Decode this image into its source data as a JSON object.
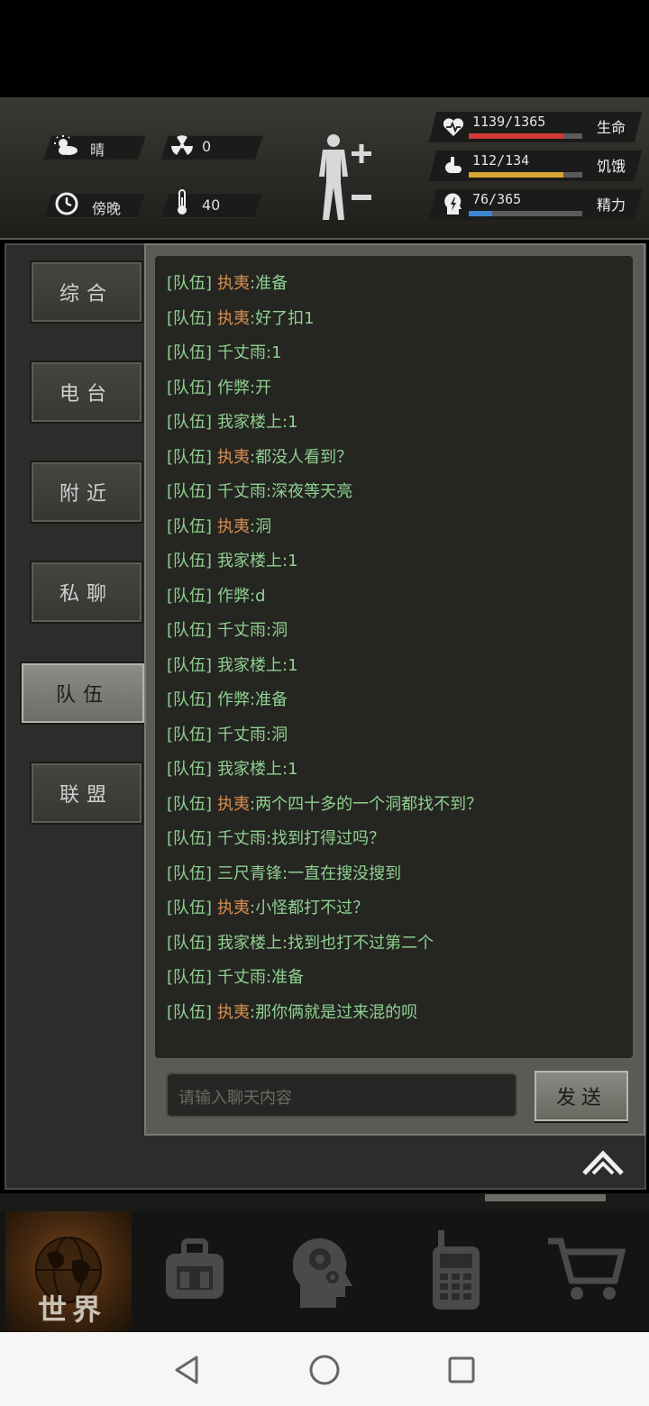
{
  "hud": {
    "weather": {
      "label": "晴",
      "icon": "partly-cloudy-icon"
    },
    "radiation": {
      "value": "0",
      "icon": "radiation-icon"
    },
    "time": {
      "label": "傍晚",
      "icon": "clock-icon"
    },
    "temperature": {
      "value": "40",
      "icon": "thermometer-icon"
    },
    "stats": [
      {
        "name": "health",
        "label": "生命",
        "value": "1139/1365",
        "fraction": 0.834,
        "color": "#d23a36",
        "icon": "heart-icon"
      },
      {
        "name": "hunger",
        "label": "饥饿",
        "value": "112/134",
        "fraction": 0.836,
        "color": "#d6a431",
        "icon": "stomach-icon"
      },
      {
        "name": "energy",
        "label": "精力",
        "value": "76/365",
        "fraction": 0.208,
        "color": "#3f86cf",
        "icon": "energy-head-icon"
      }
    ]
  },
  "tabs": [
    {
      "label": "综合",
      "active": false
    },
    {
      "label": "电台",
      "active": false
    },
    {
      "label": "附近",
      "active": false
    },
    {
      "label": "私聊",
      "active": false
    },
    {
      "label": "队伍",
      "active": true
    },
    {
      "label": "联盟",
      "active": false
    }
  ],
  "chat": {
    "channel_tag": "[队伍]",
    "messages": [
      {
        "sender": "执夷",
        "text": ":准备",
        "highlight": true
      },
      {
        "sender": "执夷",
        "text": ":好了扣1",
        "highlight": true
      },
      {
        "sender": "千丈雨",
        "text": ":1",
        "highlight": false
      },
      {
        "sender": "作弊",
        "text": ":开",
        "highlight": false
      },
      {
        "sender": "我家楼上",
        "text": ":1",
        "highlight": false
      },
      {
        "sender": "执夷",
        "text": ":都没人看到？",
        "highlight": true
      },
      {
        "sender": "千丈雨",
        "text": ":深夜等天亮",
        "highlight": false
      },
      {
        "sender": "执夷",
        "text": ":洞",
        "highlight": true
      },
      {
        "sender": "我家楼上",
        "text": ":1",
        "highlight": false
      },
      {
        "sender": "作弊",
        "text": ":d",
        "highlight": false
      },
      {
        "sender": "千丈雨",
        "text": ":洞",
        "highlight": false
      },
      {
        "sender": "我家楼上",
        "text": ":1",
        "highlight": false
      },
      {
        "sender": "作弊",
        "text": ":准备",
        "highlight": false
      },
      {
        "sender": "千丈雨",
        "text": ":洞",
        "highlight": false
      },
      {
        "sender": "我家楼上",
        "text": ":1",
        "highlight": false
      },
      {
        "sender": "执夷",
        "text": ":两个四十多的一个洞都找不到？",
        "highlight": true
      },
      {
        "sender": "千丈雨",
        "text": ":找到打得过吗？",
        "highlight": false
      },
      {
        "sender": "三尺青锋",
        "text": ":一直在搜没搜到",
        "highlight": false
      },
      {
        "sender": "执夷",
        "text": ":小怪都打不过？",
        "highlight": true
      },
      {
        "sender": "我家楼上",
        "text": ":找到也打不过第二个",
        "highlight": false
      },
      {
        "sender": "千丈雨",
        "text": ":准备",
        "highlight": false
      },
      {
        "sender": "执夷",
        "text": ":那你俩就是过来混的呗",
        "highlight": true
      }
    ],
    "input_placeholder": "请输入聊天内容",
    "send_label": "发送"
  },
  "bottom_nav": [
    {
      "label": "世界",
      "icon": "globe-icon",
      "active": true
    },
    {
      "label": "",
      "icon": "backpack-icon",
      "active": false
    },
    {
      "label": "",
      "icon": "skills-head-icon",
      "active": false
    },
    {
      "label": "",
      "icon": "radio-walkie-icon",
      "active": false
    },
    {
      "label": "",
      "icon": "shopping-cart-icon",
      "active": false
    }
  ],
  "system_nav": [
    {
      "icon": "back-triangle-icon"
    },
    {
      "icon": "home-circle-icon"
    },
    {
      "icon": "recents-square-icon"
    }
  ]
}
